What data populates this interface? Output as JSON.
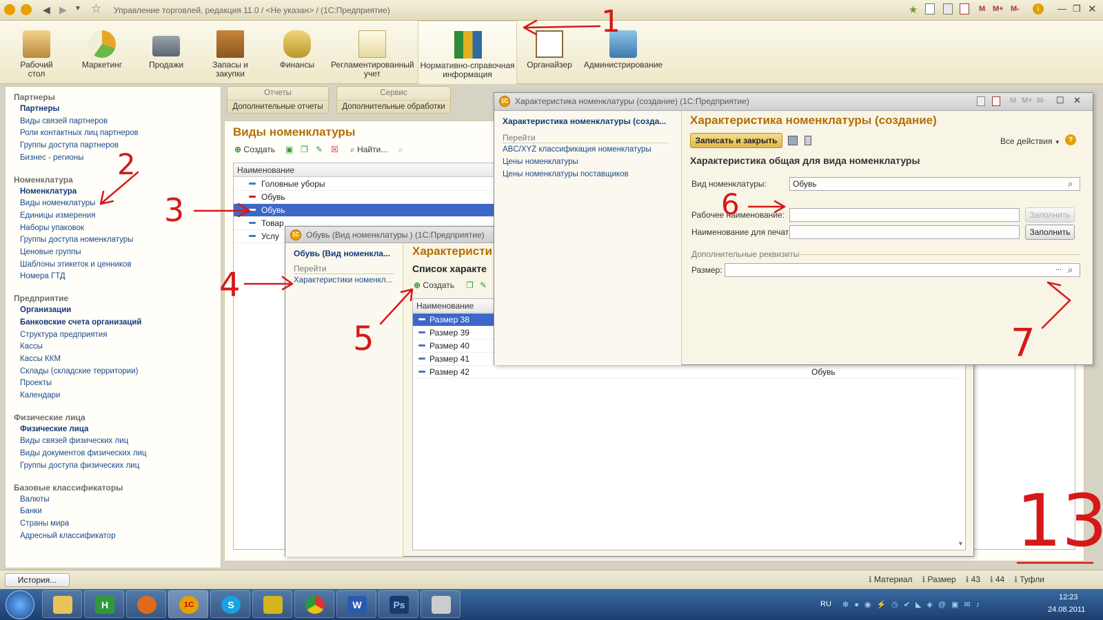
{
  "window": {
    "title": "Управление торговлей, редакция 11.0 / <Не указан> / (1С:Предприятие)",
    "mode_buttons": [
      "M",
      "M+",
      "M-"
    ]
  },
  "sections": [
    {
      "label": "Рабочий\nстол",
      "icon": "desk-icon"
    },
    {
      "label": "Маркетинг",
      "icon": "pie-chart-icon"
    },
    {
      "label": "Продажи",
      "icon": "truck-icon"
    },
    {
      "label": "Запасы и\nзакупки",
      "icon": "boxes-icon"
    },
    {
      "label": "Финансы",
      "icon": "coins-icon"
    },
    {
      "label": "Регламентированный\nучет",
      "icon": "documents-icon"
    },
    {
      "label": "Нормативно-справочная\nинформация",
      "icon": "binders-icon"
    },
    {
      "label": "Органайзер",
      "icon": "clipboard-icon"
    },
    {
      "label": "Администрирование",
      "icon": "computer-icon"
    }
  ],
  "nav": {
    "groups": [
      {
        "title": "Партнеры",
        "items": [
          {
            "label": "Партнеры",
            "bold": true
          },
          {
            "label": "Виды связей партнеров"
          },
          {
            "label": "Роли контактных лиц партнеров"
          },
          {
            "label": "Группы доступа партнеров"
          },
          {
            "label": "Бизнес - регионы"
          }
        ]
      },
      {
        "title": "Номенклатура",
        "items": [
          {
            "label": "Номенклатура",
            "bold": true
          },
          {
            "label": "Виды номенклатуры"
          },
          {
            "label": "Единицы измерения"
          },
          {
            "label": "Наборы упаковок"
          },
          {
            "label": "Группы доступа номенклатуры"
          },
          {
            "label": "Ценовые группы"
          },
          {
            "label": "Шаблоны этикеток и ценников"
          },
          {
            "label": "Номера ГТД"
          }
        ]
      },
      {
        "title": "Предприятие",
        "items": [
          {
            "label": "Организации",
            "bold": true
          },
          {
            "label": "Банковские счета организаций",
            "bold": true
          },
          {
            "label": "Структура предприятия"
          },
          {
            "label": "Кассы"
          },
          {
            "label": "Кассы ККМ"
          },
          {
            "label": "Склады (складские территории)"
          },
          {
            "label": "Проекты"
          },
          {
            "label": "Календари"
          }
        ]
      },
      {
        "title": "Физические лица",
        "items": [
          {
            "label": "Физические лица",
            "bold": true
          },
          {
            "label": "Виды связей физических лиц"
          },
          {
            "label": "Виды документов физических лиц"
          },
          {
            "label": "Группы доступа физических лиц"
          }
        ]
      },
      {
        "title": "Базовые классификаторы",
        "items": [
          {
            "label": "Валюты"
          },
          {
            "label": "Банки"
          },
          {
            "label": "Страны мира"
          },
          {
            "label": "Адресный классификатор"
          }
        ]
      }
    ]
  },
  "commands": {
    "reports_title": "Отчеты",
    "reports_item": "Дополнительные отчеты",
    "service_title": "Сервис",
    "service_item": "Дополнительные обработки"
  },
  "list_form": {
    "title": "Виды номенклатуры",
    "create": "Создать",
    "find": "Найти...",
    "column": "Наименование",
    "rows": [
      {
        "name": "Головные уборы"
      },
      {
        "name": "Обувь",
        "deleted": true
      },
      {
        "name": "Обувь",
        "selected": true
      },
      {
        "name": "Товар"
      },
      {
        "name": "Услу"
      }
    ]
  },
  "obuv_window": {
    "title": "Обувь (Вид номенклатуры ) (1С:Предприятие)",
    "side_title": "Обувь (Вид номенкла...",
    "goto": "Перейти",
    "link": "Характеристики номенкл...",
    "form_title": "Характеристи",
    "subtitle": "Список характе",
    "create": "Создать",
    "column": "Наименование",
    "rows": [
      {
        "name": "Размер 38",
        "selected": true
      },
      {
        "name": "Размер 39"
      },
      {
        "name": "Размер 40"
      },
      {
        "name": "Размер 41"
      },
      {
        "name": "Размер 42",
        "kind": "Обувь"
      }
    ]
  },
  "char_window": {
    "title": "Характеристика номенклатуры (создание) (1С:Предприятие)",
    "side_title": "Характеристика номенклатуры (созда...",
    "goto": "Перейти",
    "links": [
      "ABC/XYZ классификация номенклатуры",
      "Цены номенклатуры",
      "Цены номенклатуры поставщиков"
    ],
    "form_title": "Характеристика номенклатуры (создание)",
    "save_close": "Записать и закрыть",
    "all_actions": "Все действия",
    "section_title": "Характеристика общая для вида номенклатуры",
    "vid_label": "Вид номенклатуры:",
    "vid_value": "Обувь",
    "work_name_label": "Рабочее наименование:",
    "work_name_value": "",
    "print_name_label": "Наименование для печати:",
    "print_name_value": "",
    "fill": "Заполнить",
    "extra_title": "Дополнительные реквизиты",
    "size_label": "Размер:",
    "size_value": ""
  },
  "status": {
    "history": "История...",
    "items": [
      "Материал",
      "Размер",
      "43",
      "44",
      "Туфли"
    ]
  },
  "taskbar": {
    "lang": "RU",
    "time": "12:23",
    "date": "24.08.2011"
  },
  "annotations": {
    "n1": "1",
    "n2": "2",
    "n3": "3",
    "n4": "4",
    "n5": "5",
    "n6": "6",
    "n7": "7",
    "n13": "13"
  }
}
